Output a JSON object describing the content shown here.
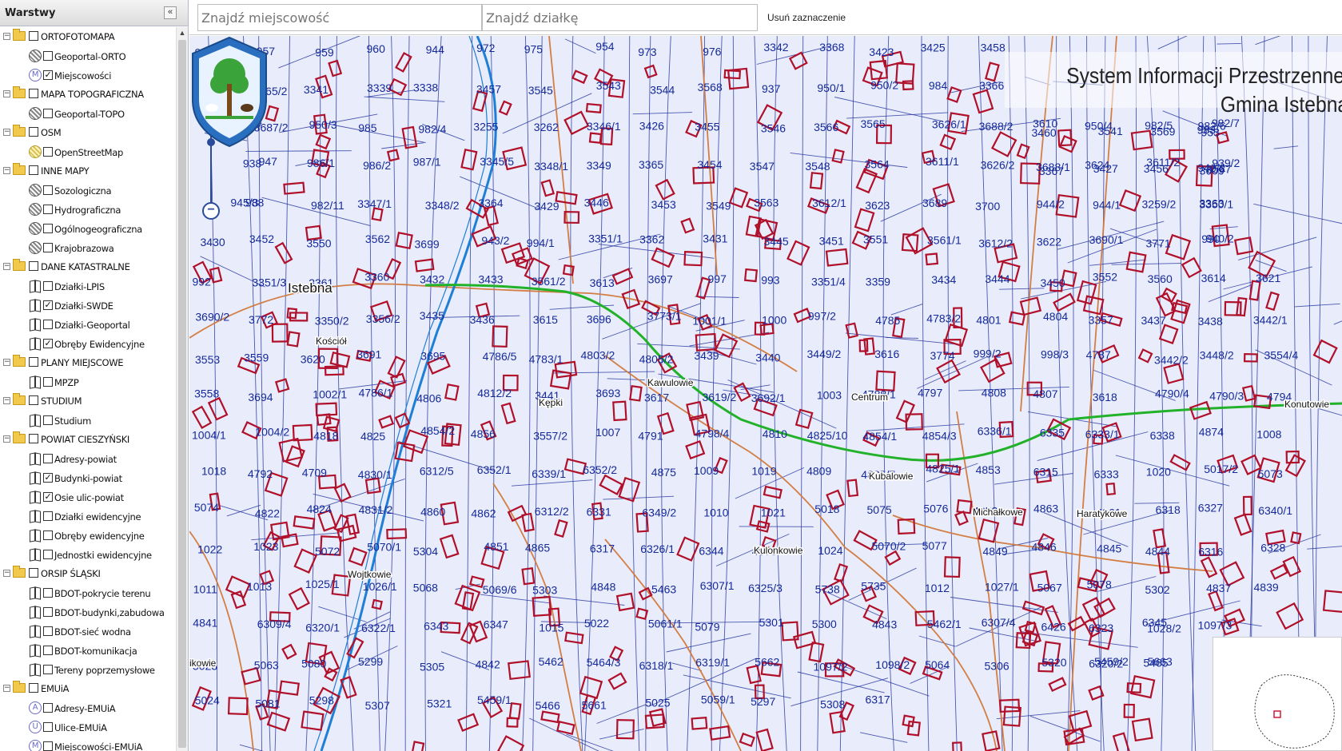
{
  "sidebar": {
    "title": "Warstwy",
    "collapse_glyph": "«",
    "scroll_up_glyph": "▲",
    "groups": [
      {
        "label": "ORTOFOTOMAPA",
        "layers": [
          {
            "label": "Geoportal-ORTO",
            "icon": "wms-globe-icon",
            "checked": false
          },
          {
            "label": "Miejscowości",
            "icon": "letter-m-icon",
            "letter": "M",
            "checked": true
          }
        ]
      },
      {
        "label": "MAPA TOPOGRAFICZNA",
        "layers": [
          {
            "label": "Geoportal-TOPO",
            "icon": "wms-globe-icon",
            "checked": false
          }
        ]
      },
      {
        "label": "OSM",
        "layers": [
          {
            "label": "OpenStreetMap",
            "icon": "osm-globe-icon",
            "checked": false
          }
        ]
      },
      {
        "label": "INNE MAPY",
        "layers": [
          {
            "label": "Sozologiczna",
            "icon": "wms-globe-icon",
            "checked": false
          },
          {
            "label": "Hydrograficzna",
            "icon": "wms-globe-icon",
            "checked": false
          },
          {
            "label": "Ogólnogeograficzna",
            "icon": "wms-globe-icon",
            "checked": false
          },
          {
            "label": "Krajobrazowa",
            "icon": "wms-globe-icon",
            "checked": false
          }
        ]
      },
      {
        "label": "DANE KATASTRALNE",
        "layers": [
          {
            "label": "Działki-LPIS",
            "icon": "book-icon",
            "checked": false
          },
          {
            "label": "Działki-SWDE",
            "icon": "book-icon",
            "checked": true
          },
          {
            "label": "Działki-Geoportal",
            "icon": "book-icon",
            "checked": false
          },
          {
            "label": "Obręby Ewidencyjne",
            "icon": "book-icon",
            "checked": true
          }
        ]
      },
      {
        "label": "PLANY MIEJSCOWE",
        "layers": [
          {
            "label": "MPZP",
            "icon": "book-icon",
            "checked": false
          }
        ]
      },
      {
        "label": "STUDIUM",
        "layers": [
          {
            "label": "Studium",
            "icon": "book-icon",
            "checked": false
          }
        ]
      },
      {
        "label": "POWIAT CIESZYŃSKI",
        "layers": [
          {
            "label": "Adresy-powiat",
            "icon": "book-icon",
            "checked": false
          },
          {
            "label": "Budynki-powiat",
            "icon": "book-icon",
            "checked": true
          },
          {
            "label": "Osie ulic-powiat",
            "icon": "book-icon",
            "checked": true
          },
          {
            "label": "Działki ewidencyjne",
            "icon": "book-icon",
            "checked": false
          },
          {
            "label": "Obręby ewidencyjne",
            "icon": "book-icon",
            "checked": false
          },
          {
            "label": "Jednostki ewidencyjne",
            "icon": "book-icon",
            "checked": false
          }
        ]
      },
      {
        "label": "ORSIP ŚLĄSKI",
        "layers": [
          {
            "label": "BDOT-pokrycie terenu",
            "icon": "book-icon",
            "checked": false
          },
          {
            "label": "BDOT-budynki,zabudowa",
            "icon": "book-icon",
            "checked": false
          },
          {
            "label": "BDOT-sieć wodna",
            "icon": "book-icon",
            "checked": false
          },
          {
            "label": "BDOT-komunikacja",
            "icon": "book-icon",
            "checked": false
          },
          {
            "label": "Tereny poprzemysłowe",
            "icon": "book-icon",
            "checked": false
          }
        ]
      },
      {
        "label": "EMUiA",
        "layers": [
          {
            "label": "Adresy-EMUiA",
            "icon": "letter-a-icon",
            "letter": "A",
            "checked": false
          },
          {
            "label": "Ulice-EMUiA",
            "icon": "letter-u-icon",
            "letter": "U",
            "checked": false
          },
          {
            "label": "Miejscowości-EMUiA",
            "icon": "letter-m-icon",
            "letter": "M",
            "checked": false
          }
        ]
      }
    ]
  },
  "topbar": {
    "search_place_placeholder": "Znajdź miejscowość",
    "search_parcel_placeholder": "Znajdź działkę",
    "clear_selection": "Usuń zaznaczenie"
  },
  "map": {
    "title_line1": "System Informacji Przestrzennej",
    "title_line2": "Gmina Istebna",
    "zoom_in": "+",
    "zoom_out": "−",
    "colors": {
      "background": "#e9ecfa",
      "parcel_lines": "#2233a0",
      "parcel_numbers": "#152a9a",
      "buildings": "#b0102a",
      "roads": "#d2783a",
      "river": "#1e7fd6",
      "highlight_road": "#22b22a"
    },
    "place_names": [
      {
        "name": "Istebna"
      },
      {
        "name": "Kościół"
      },
      {
        "name": "Kępki"
      },
      {
        "name": "Kawulowie"
      },
      {
        "name": "Centrum"
      },
      {
        "name": "Kubalowie"
      },
      {
        "name": "Michałkowe"
      },
      {
        "name": "Haratykowe"
      },
      {
        "name": "Kulonkowie"
      },
      {
        "name": "Wojtkowie"
      },
      {
        "name": "Konutowie"
      },
      {
        "name": "ikowie"
      }
    ],
    "parcel_numbers": [
      "956",
      "957",
      "959",
      "960",
      "944",
      "972",
      "975",
      "954",
      "973",
      "976",
      "3342",
      "3368",
      "3423",
      "3425",
      "3458",
      "3460",
      "3541",
      "3569",
      "953",
      "983",
      "980/6",
      "3265/2",
      "3341",
      "3339",
      "3338",
      "3457",
      "3545",
      "3543",
      "3544",
      "3568",
      "937",
      "950/1",
      "950/2",
      "984",
      "3366",
      "3367",
      "3427",
      "3456",
      "3567",
      "3609",
      "3627",
      "3687/2",
      "950/3",
      "985",
      "982/4",
      "3255",
      "3262",
      "3346/1",
      "3426",
      "3455",
      "3546",
      "3566",
      "3565",
      "3626/1",
      "3688/2",
      "3610",
      "950/4",
      "982/5",
      "982/7",
      "982/6",
      "938",
      "947",
      "986/1",
      "986/2",
      "987/1",
      "3345/5",
      "3348/1",
      "3349",
      "3365",
      "3454",
      "3547",
      "3548",
      "3564",
      "3611/1",
      "3626/2",
      "3688/1",
      "3624",
      "3611/2",
      "939/2",
      "946/2",
      "945/3",
      "988",
      "982/11",
      "3347/1",
      "3348/2",
      "3364",
      "3429",
      "3446",
      "3453",
      "3549",
      "3563",
      "3612/1",
      "3623",
      "3689",
      "3700",
      "944/2",
      "944/1",
      "3259/2",
      "3350/1",
      "3363",
      "3430",
      "3452",
      "3550",
      "3562",
      "3699",
      "943/2",
      "994/1",
      "3351/1",
      "3362",
      "3431",
      "3445",
      "3451",
      "3551",
      "3561/1",
      "3612/2",
      "3622",
      "3690/1",
      "3771",
      "940/2",
      "990",
      "992",
      "3351/3",
      "3361",
      "3360",
      "3432",
      "3433",
      "3561/2",
      "3613",
      "3697",
      "997",
      "993",
      "3351/4",
      "3359",
      "3434",
      "3444",
      "3450",
      "3552",
      "3560",
      "3614",
      "3621",
      "3690/2",
      "3772",
      "3350/2",
      "3356/2",
      "3435",
      "3436",
      "3615",
      "3696",
      "3773/1",
      "1001/1",
      "1000",
      "997/2",
      "4785",
      "4783/2",
      "4801",
      "4804",
      "3357",
      "3437",
      "3438",
      "3442/1",
      "3553",
      "3559",
      "3620",
      "3691",
      "3695",
      "4786/5",
      "4783/1",
      "4803/2",
      "4805/2",
      "3439",
      "3440",
      "3449/2",
      "3616",
      "3774",
      "999/2",
      "998/3",
      "4787",
      "3442/2",
      "3448/2",
      "3554/4",
      "3558",
      "3694",
      "1002/1",
      "4786/1",
      "4806",
      "4812/2",
      "3441",
      "3693",
      "3617",
      "3619/2",
      "3692/1",
      "1003",
      "4788/1",
      "4797",
      "4808",
      "4807",
      "3618",
      "4790/4",
      "4790/3",
      "4794",
      "1004/1",
      "1004/2",
      "4818",
      "4825",
      "4854/2",
      "4856",
      "3557/2",
      "1007",
      "4791",
      "4798/4",
      "4810",
      "4825/10",
      "4854/1",
      "4854/3",
      "6336/1",
      "6335",
      "6333/1",
      "6338",
      "4874",
      "1008",
      "1018",
      "4792",
      "4709",
      "4830/1",
      "6312/5",
      "6352/1",
      "6339/1",
      "6352/2",
      "4875",
      "1009",
      "1019",
      "4809",
      "4825/7",
      "4825/1",
      "4853",
      "6315",
      "6333",
      "1020",
      "5017/2",
      "5073",
      "5074",
      "4822",
      "4824",
      "4831/2",
      "4860",
      "4862",
      "6312/2",
      "6331",
      "6349/2",
      "1010",
      "1021",
      "5018",
      "5075",
      "5076",
      "4852",
      "4863",
      "4861",
      "6318",
      "6327",
      "6340/1",
      "1022",
      "1023",
      "5072",
      "5070/1",
      "5304",
      "4851",
      "4865",
      "6317",
      "6326/1",
      "6344",
      "4876",
      "1024",
      "5070/2",
      "5077",
      "4849",
      "4846",
      "4845",
      "4844",
      "6316",
      "6328",
      "1011",
      "1013",
      "1025/1",
      "1026/1",
      "5068",
      "5069/6",
      "5303",
      "4848",
      "5463",
      "6307/1",
      "6325/3",
      "5738",
      "5735",
      "1012",
      "1027/1",
      "5067",
      "5078",
      "5302",
      "4837",
      "4839",
      "4841",
      "6309/4",
      "6320/1",
      "6322/1",
      "6343",
      "6347",
      "1015",
      "5022",
      "5061/1",
      "5079",
      "5301",
      "5300",
      "4843",
      "5462/1",
      "6307/4",
      "6426",
      "6323",
      "6345",
      "1097/3",
      "1028/2",
      "5023",
      "5063",
      "5080",
      "5299",
      "5305",
      "4842",
      "5462",
      "5464/3",
      "6318/1",
      "6319/1",
      "5662",
      "1097/2",
      "1098/2",
      "5064",
      "5306",
      "5320",
      "5459/2",
      "5465",
      "6320/2",
      "5663",
      "5024",
      "5081",
      "5298",
      "5307",
      "5321",
      "5459/1",
      "5466",
      "5661",
      "5025",
      "5059/1",
      "5297",
      "5308",
      "6317"
    ]
  }
}
